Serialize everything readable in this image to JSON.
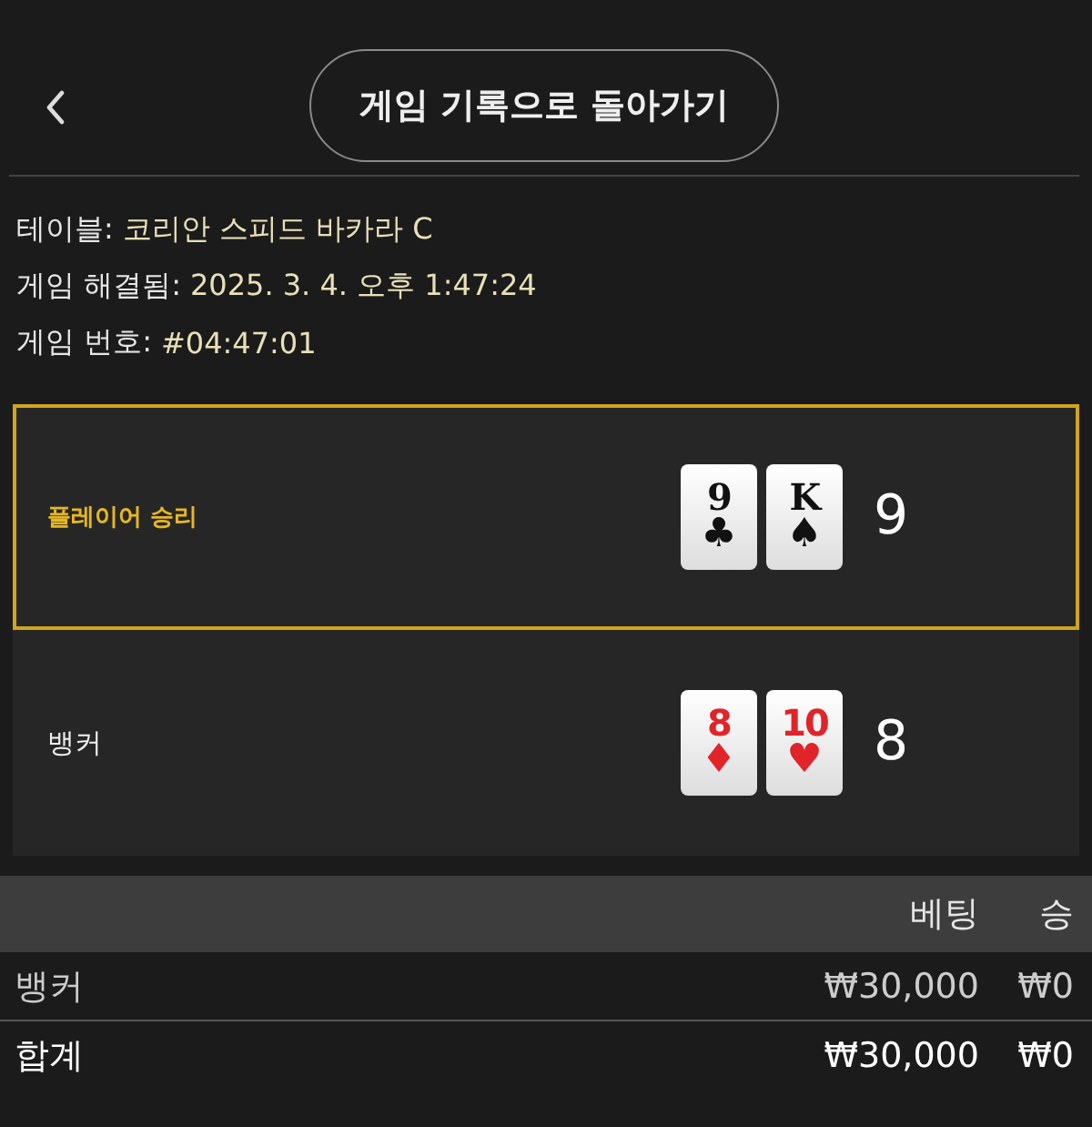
{
  "header": {
    "button": "게임 기록으로 돌아가기"
  },
  "info": [
    {
      "label": "테이블:",
      "value": "코리안 스피드 바카라 C"
    },
    {
      "label": "게임 해결됨:",
      "value": "2025. 3. 4. 오후 1:47:24"
    },
    {
      "label": "게임 번호:",
      "value": "#04:47:01"
    }
  ],
  "hands": [
    {
      "label": "플레이어 승리",
      "winner": true,
      "cards": [
        {
          "rank": "9",
          "suit": "♣",
          "color": "#111111"
        },
        {
          "rank": "K",
          "suit": "♠",
          "color": "#111111"
        }
      ],
      "score": "9"
    },
    {
      "label": "뱅커",
      "winner": false,
      "cards": [
        {
          "rank": "8",
          "suit": "♦",
          "color": "#e0242a"
        },
        {
          "rank": "10",
          "suit": "♥",
          "color": "#e0242a"
        }
      ],
      "score": "8"
    }
  ],
  "table": {
    "columns": [
      "",
      "베팅",
      "승"
    ],
    "rows": [
      {
        "kind": "item",
        "cells": [
          "뱅커",
          "₩30,000",
          "₩0"
        ]
      },
      {
        "kind": "total",
        "cells": [
          "합계",
          "₩30,000",
          "₩0"
        ]
      }
    ]
  }
}
